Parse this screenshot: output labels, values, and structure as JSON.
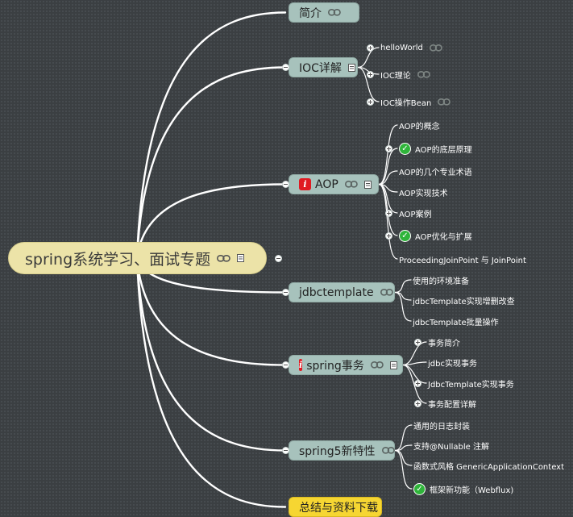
{
  "root": {
    "label": "spring系统学习、面试专题"
  },
  "topics": [
    {
      "id": "intro",
      "label": "简介",
      "links": true,
      "note": false,
      "warn": false,
      "children": []
    },
    {
      "id": "ioc",
      "label": "IOC详解",
      "links": false,
      "note": true,
      "warn": false,
      "children": [
        {
          "label": "helloWorld",
          "link": true,
          "check": false
        },
        {
          "label": "IOC理论",
          "link": true,
          "check": false
        },
        {
          "label": "IOC操作Bean",
          "link": true,
          "check": false
        }
      ]
    },
    {
      "id": "aop",
      "label": "AOP",
      "links": true,
      "note": true,
      "warn": true,
      "children": [
        {
          "label": "AOP的概念",
          "link": false,
          "check": false
        },
        {
          "label": "AOP的底层原理",
          "link": false,
          "check": true
        },
        {
          "label": "AOP的几个专业术语",
          "link": false,
          "check": false
        },
        {
          "label": "AOP实现技术",
          "link": false,
          "check": false
        },
        {
          "label": "AOP案例",
          "link": false,
          "check": false
        },
        {
          "label": "AOP优化与扩展",
          "link": false,
          "check": true
        },
        {
          "label": "ProceedingJoinPoint 与 JoinPoint",
          "link": false,
          "check": false
        }
      ]
    },
    {
      "id": "jdbc",
      "label": "jdbctemplate",
      "links": true,
      "note": false,
      "warn": false,
      "children": [
        {
          "label": "使用的环境准备",
          "link": false,
          "check": false
        },
        {
          "label": "jdbcTemplate实现增删改查",
          "link": false,
          "check": false
        },
        {
          "label": "jdbcTemplate批量操作",
          "link": false,
          "check": false
        }
      ]
    },
    {
      "id": "tx",
      "label": "spring事务",
      "links": true,
      "note": true,
      "warn": true,
      "children": [
        {
          "label": "事务简介",
          "link": false,
          "check": false
        },
        {
          "label": "jdbc实现事务",
          "link": false,
          "check": false
        },
        {
          "label": "JdbcTemplate实现事务",
          "link": false,
          "check": false
        },
        {
          "label": "事务配置详解",
          "link": false,
          "check": false
        }
      ]
    },
    {
      "id": "s5",
      "label": "spring5新特性",
      "links": true,
      "note": false,
      "warn": false,
      "children": [
        {
          "label": "通用的日志封装",
          "link": false,
          "check": false
        },
        {
          "label": "支持@Nullable 注解",
          "link": false,
          "check": false
        },
        {
          "label": "函数式风格 GenericApplicationContext",
          "link": false,
          "check": false
        },
        {
          "label": "框架新功能（Webflux)",
          "link": false,
          "check": true
        }
      ]
    },
    {
      "id": "summary",
      "label": "总结与资料下载",
      "links": false,
      "note": false,
      "warn": false,
      "yellow": true,
      "children": []
    }
  ],
  "colors": {
    "background": "#3b3f42",
    "topic": "#a7c2bc",
    "root": "#ece3a8",
    "highlight": "#f6d632",
    "warn": "#e01b22",
    "check": "#2fb43a",
    "edge": "#ffffff"
  },
  "icons": {
    "link": "link-icon",
    "note": "note-icon",
    "warn": "warning-flag-icon",
    "check": "check-circle-icon",
    "expand": "expand-toggle-icon"
  }
}
